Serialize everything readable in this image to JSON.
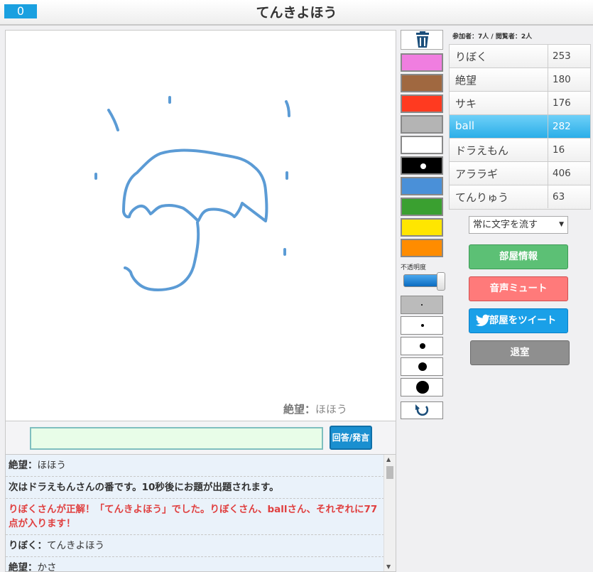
{
  "header": {
    "counter": "0",
    "title": "てんきよほう"
  },
  "canvas": {
    "drawer_name": "絶望",
    "drawer_sep": "：",
    "drawer_answer": "ほほう"
  },
  "answer": {
    "button_label": "回答/発言",
    "value": ""
  },
  "chat": [
    {
      "type": "msg",
      "who": "絶望",
      "sep": "：",
      "text": "ほほう"
    },
    {
      "type": "sys",
      "text": "次はドラえもんさんの番です。10秒後にお題が出題されます。"
    },
    {
      "type": "correct",
      "text": "りぼくさんが正解！「てんきよほう」でした。りぼくさん、ballさん、それぞれに77点が入ります！"
    },
    {
      "type": "msg",
      "who": "りぼく",
      "sep": "：",
      "text": "てんきよほう"
    },
    {
      "type": "msg",
      "who": "絶望",
      "sep": "：",
      "text": "かさ"
    }
  ],
  "palette": {
    "colors": [
      "#f07ee0",
      "#a06840",
      "#ff3a20",
      "#b4b4b4",
      "#ffffff",
      "#000000",
      "#4a90d8",
      "#3aa030",
      "#ffe600",
      "#ff8c00"
    ],
    "selected_index": 5,
    "opacity_label": "不透明度",
    "opacity_value": 1.0
  },
  "pen_sizes": {
    "selected_index": 0
  },
  "room": {
    "participants_label": "参加者：7人 / 閲覧者：2人"
  },
  "players": [
    {
      "name": "りぼく",
      "score": "253"
    },
    {
      "name": "絶望",
      "score": "180"
    },
    {
      "name": "サキ",
      "score": "176"
    },
    {
      "name": "ball",
      "score": "282",
      "me": true
    },
    {
      "name": "ドラえもん",
      "score": "16"
    },
    {
      "name": "アララギ",
      "score": "406"
    },
    {
      "name": "てんりゅう",
      "score": "63"
    }
  ],
  "controls": {
    "stream_select": "常に文字を流す",
    "room_info": "部屋情報",
    "sound_mute": "音声ミュート",
    "tweet_room": "部屋をツイート",
    "leave": "退室"
  },
  "colors": {
    "accent": "#1aa0e0",
    "stroke": "#5b9bd5"
  }
}
